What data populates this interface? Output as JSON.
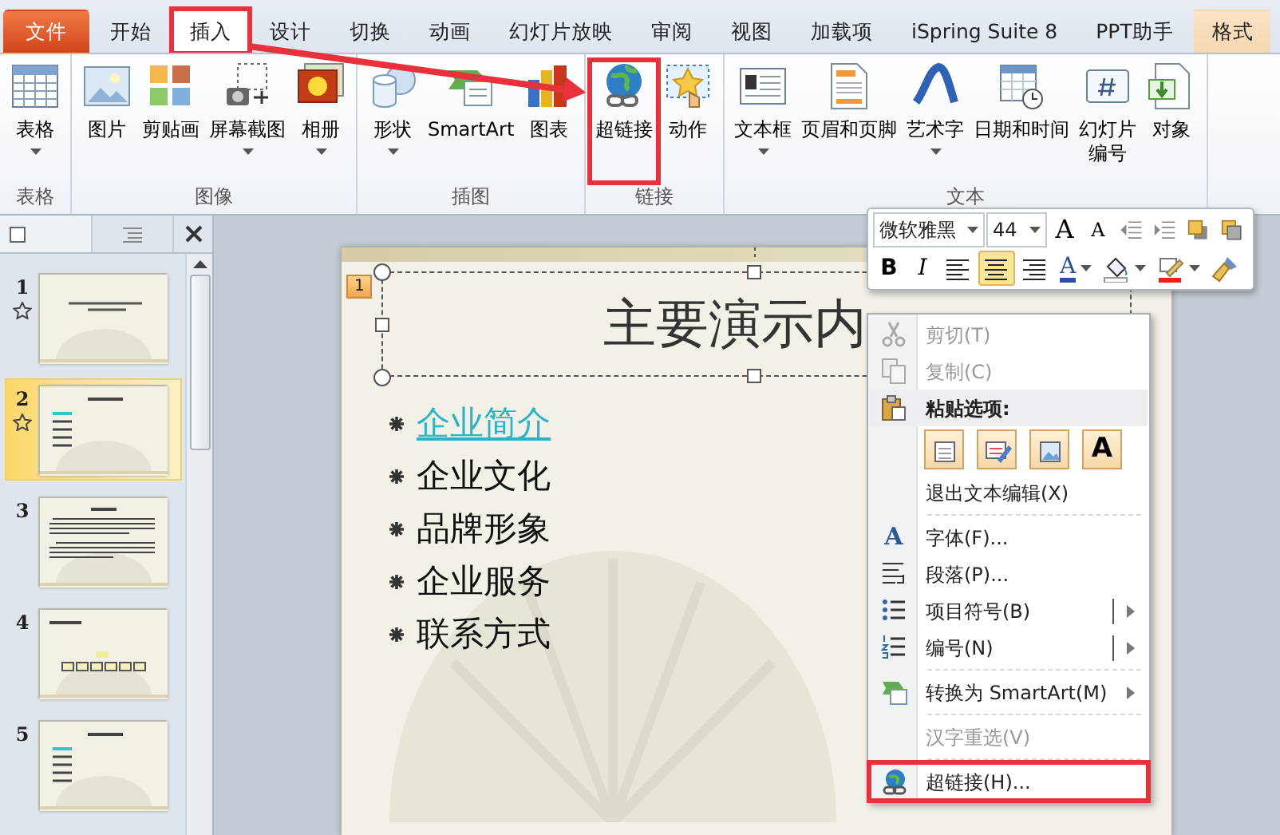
{
  "tabs": [
    {
      "label": "文件",
      "kind": "file",
      "selected": false,
      "highlighted": false
    },
    {
      "label": "开始",
      "kind": "tab",
      "selected": false,
      "highlighted": false
    },
    {
      "label": "插入",
      "kind": "tab",
      "selected": true,
      "highlighted": true
    },
    {
      "label": "设计",
      "kind": "tab",
      "selected": false,
      "highlighted": false
    },
    {
      "label": "切换",
      "kind": "tab",
      "selected": false,
      "highlighted": false
    },
    {
      "label": "动画",
      "kind": "tab",
      "selected": false,
      "highlighted": false
    },
    {
      "label": "幻灯片放映",
      "kind": "tab",
      "selected": false,
      "highlighted": false
    },
    {
      "label": "审阅",
      "kind": "tab",
      "selected": false,
      "highlighted": false
    },
    {
      "label": "视图",
      "kind": "tab",
      "selected": false,
      "highlighted": false
    },
    {
      "label": "加载项",
      "kind": "tab",
      "selected": false,
      "highlighted": false
    },
    {
      "label": "iSpring Suite 8",
      "kind": "tab",
      "selected": false,
      "highlighted": false
    },
    {
      "label": "PPT助手",
      "kind": "tab",
      "selected": false,
      "highlighted": false
    },
    {
      "label": "格式",
      "kind": "context",
      "selected": false,
      "highlighted": false
    }
  ],
  "ribbon": {
    "groups": [
      {
        "label": "表格",
        "buttons": [
          {
            "label": "表格",
            "kind": "table",
            "dropdown": true,
            "highlighted": false
          }
        ]
      },
      {
        "label": "图像",
        "buttons": [
          {
            "label": "图片",
            "kind": "picture",
            "dropdown": false,
            "highlighted": false
          },
          {
            "label": "剪贴画",
            "kind": "clipart",
            "dropdown": false,
            "highlighted": false
          },
          {
            "label": "屏幕截图",
            "kind": "screenshot",
            "dropdown": true,
            "highlighted": false
          },
          {
            "label": "相册",
            "kind": "album",
            "dropdown": true,
            "highlighted": false
          }
        ]
      },
      {
        "label": "插图",
        "buttons": [
          {
            "label": "形状",
            "kind": "shapes",
            "dropdown": true,
            "highlighted": false
          },
          {
            "label": "SmartArt",
            "kind": "smartart",
            "dropdown": false,
            "highlighted": false
          },
          {
            "label": "图表",
            "kind": "chart",
            "dropdown": false,
            "highlighted": false
          }
        ]
      },
      {
        "label": "链接",
        "buttons": [
          {
            "label": "超链接",
            "kind": "hyperlink",
            "dropdown": false,
            "highlighted": true
          },
          {
            "label": "动作",
            "kind": "action",
            "dropdown": false,
            "highlighted": false
          }
        ]
      },
      {
        "label": "文本",
        "buttons": [
          {
            "label": "文本框",
            "kind": "textbox",
            "dropdown": true,
            "highlighted": false
          },
          {
            "label": "页眉和页脚",
            "kind": "header_footer",
            "dropdown": false,
            "highlighted": false
          },
          {
            "label": "艺术字",
            "kind": "wordart",
            "dropdown": true,
            "highlighted": false
          },
          {
            "label": "日期和时间",
            "kind": "datetime",
            "dropdown": false,
            "highlighted": false
          },
          {
            "label": "幻灯片编号",
            "kind": "slide_number",
            "dropdown": false,
            "highlighted": false
          },
          {
            "label": "对象",
            "kind": "object",
            "dropdown": false,
            "highlighted": false
          }
        ]
      }
    ]
  },
  "annotation_arrow": true,
  "slide_panel": {
    "thumbnails": [
      {
        "number": "1",
        "kind": "title",
        "animated": true,
        "selected": false
      },
      {
        "number": "2",
        "kind": "list",
        "animated": true,
        "selected": true
      },
      {
        "number": "3",
        "kind": "text",
        "animated": false,
        "selected": false
      },
      {
        "number": "4",
        "kind": "diagram",
        "animated": false,
        "selected": false
      },
      {
        "number": "5",
        "kind": "list",
        "animated": false,
        "selected": false
      }
    ]
  },
  "slide": {
    "animation_badge": "1",
    "title": "主要演示内",
    "bullets": [
      {
        "text": "企业简介",
        "hyperlink": true
      },
      {
        "text": "企业文化",
        "hyperlink": false
      },
      {
        "text": "品牌形象",
        "hyperlink": false
      },
      {
        "text": "企业服务",
        "hyperlink": false
      },
      {
        "text": "联系方式",
        "hyperlink": false
      }
    ]
  },
  "mini_toolbar": {
    "font": "微软雅黑",
    "size": "44",
    "row1": [
      {
        "kind": "grow_font",
        "label": "A"
      },
      {
        "kind": "shrink_font",
        "label": "A"
      },
      {
        "kind": "outdent"
      },
      {
        "kind": "indent"
      },
      {
        "kind": "front"
      },
      {
        "kind": "back"
      }
    ],
    "row2": [
      {
        "kind": "bold",
        "label": "B",
        "selected": false
      },
      {
        "kind": "italic",
        "label": "I",
        "selected": false
      },
      {
        "kind": "align_left",
        "selected": false
      },
      {
        "kind": "align_center",
        "selected": true
      },
      {
        "kind": "align_right",
        "selected": false
      },
      {
        "kind": "font_color",
        "label": "A",
        "selected": false
      },
      {
        "kind": "fill",
        "selected": false
      },
      {
        "kind": "line_color",
        "selected": false
      },
      {
        "kind": "painter",
        "selected": false
      }
    ]
  },
  "context_menu": {
    "items": [
      {
        "kind": "cut",
        "label": "剪切(T)",
        "disabled": true,
        "submenu": false,
        "split": false,
        "highlighted": false
      },
      {
        "kind": "copy",
        "label": "复制(C)",
        "disabled": true,
        "submenu": false,
        "split": false,
        "highlighted": false
      },
      {
        "kind": "paste_header",
        "label": "粘贴选项:"
      },
      {
        "kind": "paste_options",
        "buttons": [
          {
            "kind": "source"
          },
          {
            "kind": "merge"
          },
          {
            "kind": "picture"
          },
          {
            "kind": "text",
            "label": "A"
          }
        ]
      },
      {
        "kind": "plain",
        "label": "退出文本编辑(X)",
        "disabled": false,
        "submenu": false,
        "split": false,
        "highlighted": false
      },
      {
        "kind": "separator"
      },
      {
        "kind": "font",
        "icon_text": "A",
        "label": "字体(F)...",
        "disabled": false,
        "submenu": false,
        "split": false,
        "highlighted": false
      },
      {
        "kind": "paragraph",
        "label": "段落(P)...",
        "disabled": false,
        "submenu": false,
        "split": false,
        "highlighted": false
      },
      {
        "kind": "bullets",
        "label": "项目符号(B)",
        "disabled": false,
        "submenu": true,
        "split": true,
        "highlighted": false
      },
      {
        "kind": "numbering",
        "label": "编号(N)",
        "disabled": false,
        "submenu": true,
        "split": true,
        "highlighted": false
      },
      {
        "kind": "separator"
      },
      {
        "kind": "smartart",
        "label": "转换为 SmartArt(M)",
        "disabled": false,
        "submenu": true,
        "split": false,
        "highlighted": false
      },
      {
        "kind": "separator"
      },
      {
        "kind": "plain",
        "label": "汉字重选(V)",
        "disabled": true,
        "submenu": false,
        "split": false,
        "highlighted": false
      },
      {
        "kind": "separator"
      },
      {
        "kind": "hyperlink",
        "label": "超链接(H)...",
        "disabled": false,
        "submenu": false,
        "split": false,
        "highlighted": true
      }
    ]
  }
}
